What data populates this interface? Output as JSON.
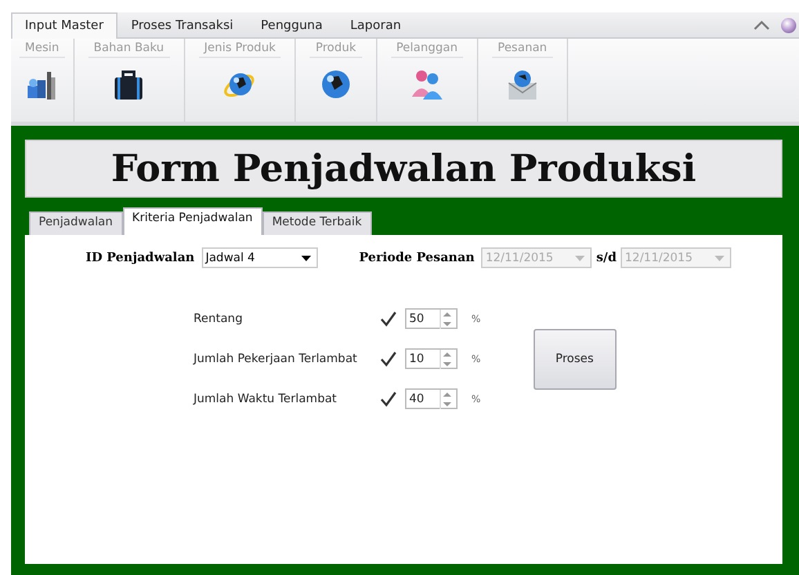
{
  "ribbon": {
    "tabs": [
      {
        "label": "Input Master",
        "selected": true
      },
      {
        "label": "Proses Transaksi",
        "selected": false
      },
      {
        "label": "Pengguna",
        "selected": false
      },
      {
        "label": "Laporan",
        "selected": false
      }
    ],
    "groups": [
      {
        "label": "Mesin"
      },
      {
        "label": "Bahan Baku"
      },
      {
        "label": "Jenis Produk"
      },
      {
        "label": "Produk"
      },
      {
        "label": "Pelanggan"
      },
      {
        "label": "Pesanan"
      }
    ]
  },
  "form": {
    "title": "Form Penjadwalan Produksi",
    "tabs": [
      {
        "label": "Penjadwalan",
        "selected": false
      },
      {
        "label": "Kriteria Penjadwalan",
        "selected": true
      },
      {
        "label": "Metode Terbaik",
        "selected": false
      }
    ],
    "id_label": "ID Penjadwalan",
    "id_value": "Jadwal 4",
    "period_label": "Periode Pesanan",
    "date_from": "12/11/2015",
    "separator": "s/d",
    "date_to": "12/11/2015",
    "dates_disabled": true,
    "criteria": [
      {
        "label": "Rentang",
        "checked": true,
        "value": "50",
        "unit": "%"
      },
      {
        "label": "Jumlah Pekerjaan Terlambat",
        "checked": true,
        "value": "10",
        "unit": "%"
      },
      {
        "label": "Jumlah Waktu Terlambat",
        "checked": true,
        "value": "40",
        "unit": "%"
      }
    ],
    "button": "Proses"
  }
}
